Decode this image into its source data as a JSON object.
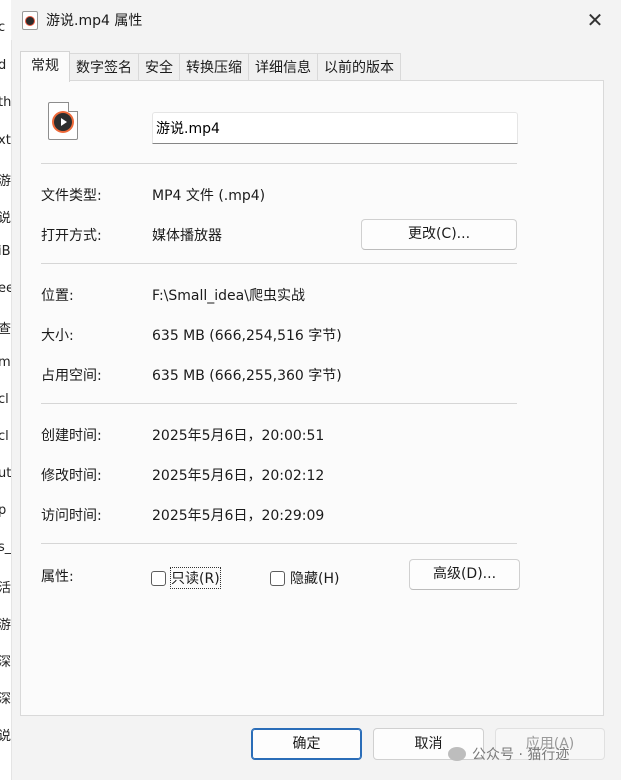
{
  "left_strip": [
    "c",
    "d",
    "th",
    "xt",
    "游",
    "说",
    "iB",
    "ee",
    "查",
    "mi",
    "cl",
    "cl",
    "ut",
    "p",
    "s_",
    "活",
    "游",
    "深",
    "深",
    "说"
  ],
  "window": {
    "title": "游说.mp4 属性",
    "close_icon": "close-icon"
  },
  "tabs": [
    "常规",
    "数字签名",
    "安全",
    "转换压缩",
    "详细信息",
    "以前的版本"
  ],
  "general": {
    "file_name": "游说.mp4",
    "type_label": "文件类型:",
    "type_value": "MP4 文件 (.mp4)",
    "opens_label": "打开方式:",
    "opens_value": "媒体播放器",
    "change_button": "更改(C)...",
    "location_label": "位置:",
    "location_value": "F:\\Small_idea\\爬虫实战",
    "size_label": "大小:",
    "size_value": "635 MB (666,254,516 字节)",
    "disk_label": "占用空间:",
    "disk_value": "635 MB (666,255,360 字节)",
    "created_label": "创建时间:",
    "created_value": "2025年5月6日，20:00:51",
    "modified_label": "修改时间:",
    "modified_value": "2025年5月6日，20:02:12",
    "accessed_label": "访问时间:",
    "accessed_value": "2025年5月6日，20:29:09",
    "attr_label": "属性:",
    "readonly_label": "只读(R)",
    "hidden_label": "隐藏(H)",
    "advanced_button": "高级(D)..."
  },
  "footer": {
    "ok": "确定",
    "cancel": "取消",
    "apply": "应用(A)"
  },
  "watermark": "公众号 · 猫行迹"
}
